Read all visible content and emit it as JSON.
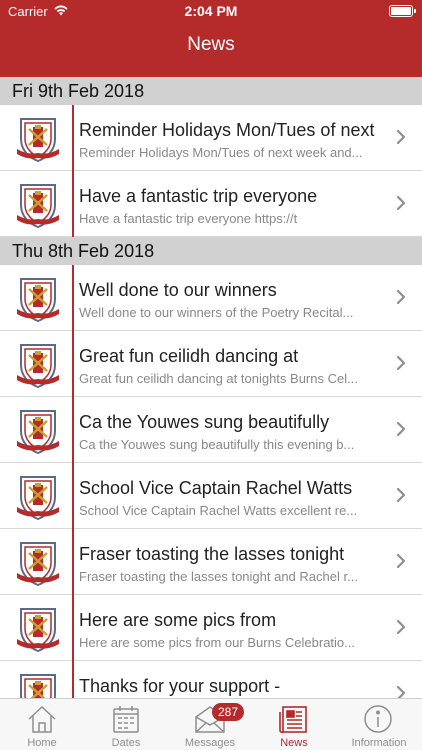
{
  "status_bar": {
    "carrier": "Carrier",
    "time": "2:04 PM"
  },
  "header": {
    "title": "News"
  },
  "sections": [
    {
      "date": "Fri 9th Feb 2018",
      "items": [
        {
          "title": "Reminder Holidays Mon/Tues of next",
          "subtitle": "Reminder Holidays Mon/Tues of next week and..."
        },
        {
          "title": "Have a fantastic trip everyone",
          "subtitle": "Have a fantastic trip everyone  https://t"
        }
      ]
    },
    {
      "date": "Thu 8th Feb 2018",
      "items": [
        {
          "title": "Well done to our winners",
          "subtitle": "Well done to our winners of the Poetry Recital..."
        },
        {
          "title": "Great fun ceilidh dancing at",
          "subtitle": "Great fun ceilidh dancing at tonights Burns Cel..."
        },
        {
          "title": "Ca the Youwes sung beautifully",
          "subtitle": "Ca the Youwes sung beautifully this evening b..."
        },
        {
          "title": "School Vice Captain Rachel Watts",
          "subtitle": "School Vice Captain Rachel Watts excellent re..."
        },
        {
          "title": "Fraser toasting the lasses tonight",
          "subtitle": "Fraser toasting the lasses tonight and Rachel r..."
        },
        {
          "title": "Here are some pics from",
          "subtitle": "Here are some pics from our Burns Celebratio..."
        },
        {
          "title": "Thanks for your support -",
          "subtitle": ""
        }
      ]
    }
  ],
  "tabs": {
    "home": "Home",
    "dates": "Dates",
    "messages": "Messages",
    "messages_badge": "287",
    "news": "News",
    "information": "Information"
  },
  "colors": {
    "accent": "#b52a2a",
    "section_bg": "#d1d1d1",
    "tab_inactive": "#8e8e8e"
  }
}
